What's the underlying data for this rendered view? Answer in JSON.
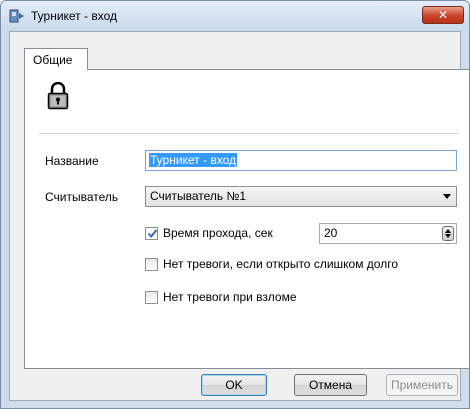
{
  "window": {
    "title": "Турникет - вход",
    "close_label": "✕"
  },
  "tabs": [
    {
      "label": "Общие"
    }
  ],
  "form": {
    "name_label": "Название",
    "name_value": "Турникет - вход",
    "reader_label": "Считыватель",
    "reader_value": "Считыватель №1",
    "pass_time_label": "Время прохода, сек",
    "pass_time_checked": true,
    "pass_time_value": "20",
    "no_alarm_open_label": "Нет тревоги, если открыто слишком долго",
    "no_alarm_open_checked": false,
    "no_alarm_break_label": "Нет тревоги при взломе",
    "no_alarm_break_checked": false
  },
  "buttons": {
    "ok": "OK",
    "cancel": "Отмена",
    "apply": "Применить"
  },
  "icons": {
    "title": "door-icon",
    "page": "lock-icon",
    "close": "close-icon"
  },
  "colors": {
    "selection": "#3399ff",
    "close_button": "#c7432a",
    "title_bar": "#cfdcec"
  }
}
